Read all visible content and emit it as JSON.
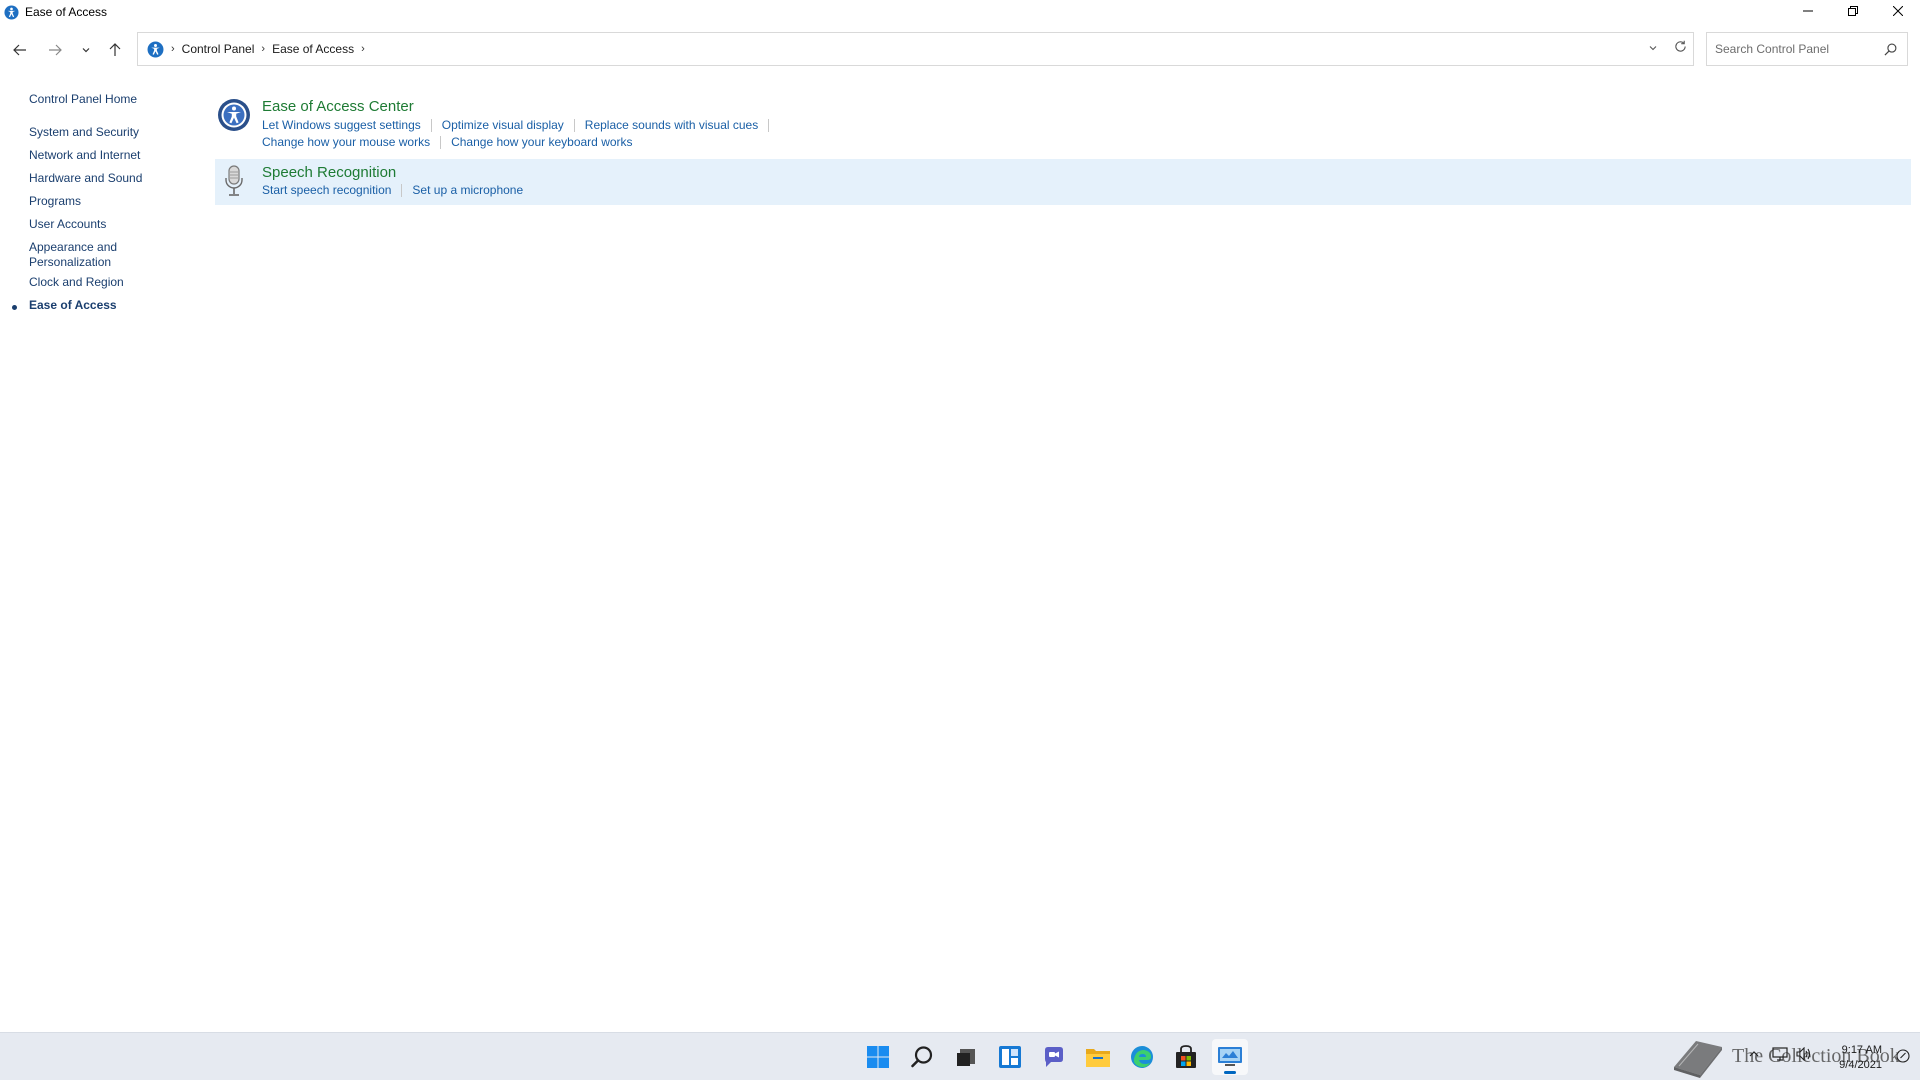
{
  "window": {
    "title": "Ease of Access"
  },
  "navigation": {
    "breadcrumbs": [
      "Control Panel",
      "Ease of Access"
    ],
    "search_placeholder": "Search Control Panel"
  },
  "sidebar": {
    "items": [
      {
        "label": "Control Panel Home",
        "active": false
      },
      {
        "label": "System and Security",
        "active": false
      },
      {
        "label": "Network and Internet",
        "active": false
      },
      {
        "label": "Hardware and Sound",
        "active": false
      },
      {
        "label": "Programs",
        "active": false
      },
      {
        "label": "User Accounts",
        "active": false
      },
      {
        "label": "Appearance and Personalization",
        "active": false
      },
      {
        "label": "Clock and Region",
        "active": false
      },
      {
        "label": "Ease of Access",
        "active": true
      }
    ]
  },
  "main": {
    "categories": [
      {
        "title": "Ease of Access Center",
        "icon": "ease-of-access-center-icon",
        "links": [
          [
            "Let Windows suggest settings",
            "Optimize visual display",
            "Replace sounds with visual cues"
          ],
          [
            "Change how your mouse works",
            "Change how your keyboard works"
          ]
        ]
      },
      {
        "title": "Speech Recognition",
        "icon": "microphone-icon",
        "links": [
          [
            "Start speech recognition",
            "Set up a microphone"
          ]
        ]
      }
    ]
  },
  "taskbar": {
    "apps": [
      "start-icon",
      "search-icon",
      "task-view-icon",
      "widgets-icon",
      "chat-icon",
      "file-explorer-icon",
      "edge-icon",
      "store-icon",
      "control-panel-icon"
    ],
    "active_app": "control-panel-icon",
    "watermark": "The Collection Book",
    "clock_time": "9:17 AM",
    "clock_date": "9/4/2021"
  },
  "colors": {
    "link": "#1a5fa6",
    "category_title": "#1e7b34",
    "sidebar_link": "#1a3e6e",
    "highlight": "#e5f1fb",
    "taskbar": "#e6eaf1"
  }
}
